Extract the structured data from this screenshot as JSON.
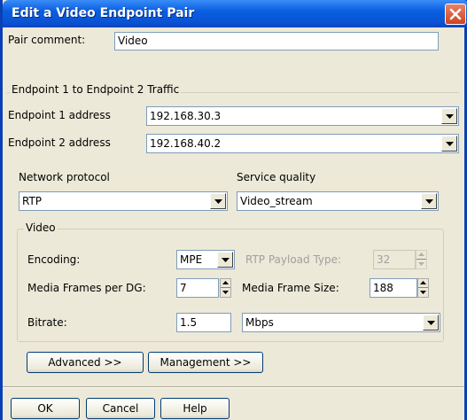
{
  "window": {
    "title": "Edit a Video Endpoint Pair"
  },
  "pair_comment": {
    "label": "Pair comment:",
    "value": "Video"
  },
  "traffic_group": {
    "legend": "Endpoint 1 to Endpoint 2 Traffic",
    "endpoint1": {
      "label": "Endpoint 1 address",
      "value": "192.168.30.3"
    },
    "endpoint2": {
      "label": "Endpoint 2 address",
      "value": "192.168.40.2"
    }
  },
  "network_protocol": {
    "label": "Network protocol",
    "value": "RTP"
  },
  "service_quality": {
    "label": "Service quality",
    "value": "Video_stream"
  },
  "video_group": {
    "legend": "Video",
    "encoding": {
      "label": "Encoding:",
      "value": "MPE"
    },
    "rtp_payload": {
      "label": "RTP Payload Type:",
      "value": "32"
    },
    "frames_per_dg": {
      "label": "Media Frames per DG:",
      "value": "7"
    },
    "frame_size": {
      "label": "Media Frame Size:",
      "value": "188"
    },
    "bitrate": {
      "label": "Bitrate:",
      "value": "1.5",
      "unit": "Mbps"
    }
  },
  "buttons": {
    "advanced": "Advanced >>",
    "management": "Management >>",
    "ok": "OK",
    "cancel": "Cancel",
    "help": "Help"
  },
  "colors": {
    "titlebar": "#0a53d4",
    "dialog_bg": "#ece9d8",
    "close_button": "#d1441f"
  },
  "icons": {
    "close": "close-icon",
    "dropdown": "chevron-down-icon",
    "spin": "spin-arrows-icon"
  }
}
